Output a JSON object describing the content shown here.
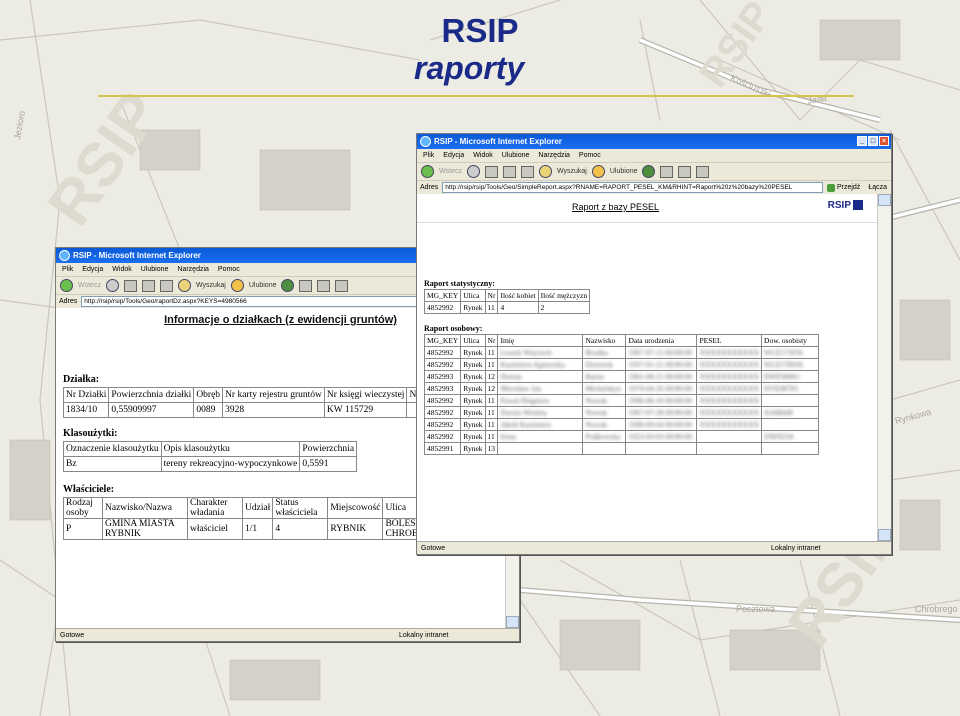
{
  "slide": {
    "title": "RSIP",
    "subtitle": "raporty"
  },
  "map_labels": {
    "jana": "Jana",
    "kosciuszki": "Kościuszki",
    "pocztowa": "Pocztowa",
    "chrobrego": "Chrobrego",
    "zwycieska": "Zwycięska",
    "rynkowa": "Rynkowa",
    "watermark": "RSIP",
    "lewa": "Jezioro"
  },
  "window1": {
    "title": "RSIP - Microsoft Internet Explorer",
    "menu": [
      "Plik",
      "Edycja",
      "Widok",
      "Ulubione",
      "Narzędzia",
      "Pomoc"
    ],
    "toolbar": {
      "back": "Wstecz",
      "search": "Wyszukaj",
      "favorites": "Ulubione"
    },
    "address_label": "Adres",
    "address": "http://rsip/rsip/Tools/Geo/raportDz.aspx?KEYS=4980566",
    "heading": "Informacje o działkach (z ewidencji gruntów)",
    "dzialka": {
      "label": "Działka:",
      "headers": [
        "Nr Działki",
        "Powierzchnia działki",
        "Obręb",
        "Nr karty rejestru gruntów",
        "Nr księgi wieczystej",
        "N"
      ],
      "row": [
        "1834/10",
        "0,55909997",
        "0089",
        "3928",
        "KW 115729",
        ""
      ]
    },
    "klasouzytki": {
      "label": "Klasoużytki:",
      "headers": [
        "Oznaczenie klasoużytku",
        "Opis klasoużytku",
        "Powierzchnia"
      ],
      "row": [
        "Bz",
        "tereny rekreacyjno-wypoczynkowe",
        "0,5591"
      ]
    },
    "wlasciciele": {
      "label": "Właściciele:",
      "headers": [
        "Rodzaj osoby",
        "Nazwisko/Nazwa",
        "Charakter władania",
        "Udział",
        "Status właściciela",
        "Miejscowość",
        "Ulica"
      ],
      "row": [
        "P",
        "GMINA MIASTA RYBNIK",
        "właściciel",
        "1/1",
        "4",
        "RYBNIK",
        "BOLESŁAWA CHROBREGO"
      ]
    },
    "status": "Gotowe",
    "zone": "Lokalny intranet"
  },
  "window2": {
    "title": "RSIP - Microsoft Internet Explorer",
    "menu": [
      "Plik",
      "Edycja",
      "Widok",
      "Ulubione",
      "Narzędzia",
      "Pomoc"
    ],
    "toolbar": {
      "back": "Wstecz",
      "search": "Wyszukaj",
      "favorites": "Ulubione"
    },
    "address_label": "Adres",
    "address": "http://rsip/rsip/Tools/Geo/SimpleReport.aspx?RNAME=RAPORT_PESEL_KM&RHINT=Raport%20z%20bazy%20PESEL",
    "go_label": "Przejdź",
    "links_label": "Łącza",
    "report_title": "Raport z bazy PESEL",
    "logo": "RSIP",
    "statystyczny": {
      "label": "Raport statystyczny:",
      "headers": [
        "MG_KEY",
        "Ulica",
        "Nr",
        "Ilość kobiet",
        "Ilość mężczyzn"
      ],
      "row": [
        "4852992",
        "Rynek",
        "11",
        "4",
        "2"
      ]
    },
    "osobowy": {
      "label": "Raport osobowy:",
      "headers": [
        "MG_KEY",
        "Ulica",
        "Nr",
        "Imię",
        "Nazwisko",
        "Data urodzenia",
        "PESEL",
        "Dow. osobisty"
      ],
      "rows": [
        [
          "4852992",
          "Rynek",
          "11",
          "Leszek Wojciech",
          "Brodka",
          "1967-07-15 00:00:00",
          "XXXXXXXXXXX",
          "WLE573936"
        ],
        [
          "4852992",
          "Rynek",
          "11",
          "Kazimiera Agnieszka",
          "Dzierżok",
          "1937-01-21 00:00:00",
          "XXXXXXXXXXX",
          "WLE578936"
        ],
        [
          "4852993",
          "Rynek",
          "12",
          "Dorota",
          "Baron",
          "1961-08-21 00:00:00",
          "XXXXXXXXXXX",
          "DWE98961"
        ],
        [
          "4852993",
          "Rynek",
          "12",
          "Mirosław Jan",
          "Michalskyn",
          "1979-04-26 00:00:00",
          "XXXXXXXXXXX",
          "DVE98781"
        ],
        [
          "4852992",
          "Rynek",
          "11",
          "Paweł Zbigniew",
          "Nowak",
          "1996-06-10 00:00:00",
          "XXXXXXXXXXX",
          ""
        ],
        [
          "4852992",
          "Rynek",
          "11",
          "Dorota Wioleta",
          "Nowak",
          "1967-07-28 00:00:00",
          "XXXXXXXXXXX",
          "AAM448"
        ],
        [
          "4852992",
          "Rynek",
          "11",
          "Jakub Kazimierz",
          "Nowak",
          "1998-09-04 00:00:00",
          "XXXXXXXXXXX",
          ""
        ],
        [
          "4852992",
          "Rynek",
          "11",
          "Irena",
          "Podkowska",
          "1923-03-03 00:00:00",
          "",
          "ZNF8234"
        ],
        [
          "4852991",
          "Rynek",
          "13",
          "",
          "",
          "",
          "",
          ""
        ]
      ]
    },
    "status": "Gotowe",
    "zone": "Lokalny intranet"
  }
}
